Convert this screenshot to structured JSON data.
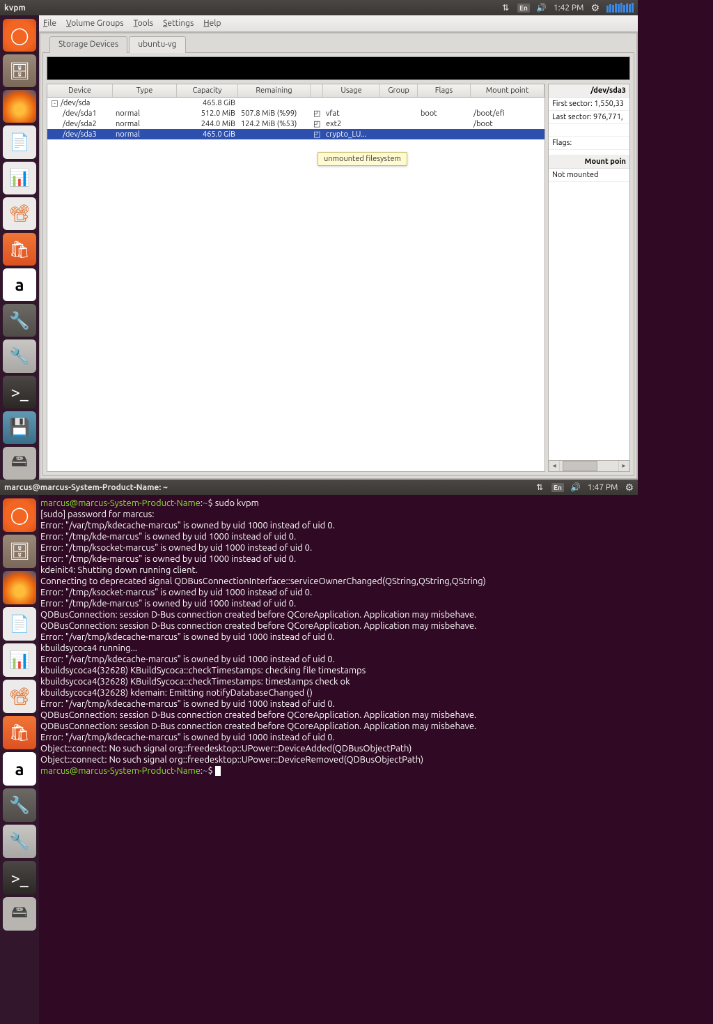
{
  "top1": {
    "title": "kvpm",
    "time": "1:42 PM",
    "lang": "En"
  },
  "top2": {
    "title": "marcus@marcus-System-Product-Name: ~",
    "time": "1:47 PM",
    "lang": "En"
  },
  "menubar": {
    "file": "File",
    "vg": "Volume Groups",
    "tools": "Tools",
    "settings": "Settings",
    "help": "Help"
  },
  "tabs": {
    "storage": "Storage Devices",
    "vg": "ubuntu-vg"
  },
  "columns": {
    "device": "Device",
    "type": "Type",
    "capacity": "Capacity",
    "remaining": "Remaining",
    "usage": "Usage",
    "group": "Group",
    "flags": "Flags",
    "mount": "Mount point"
  },
  "rows": [
    {
      "device": "/dev/sda",
      "type": "",
      "capacity": "465.8 GiB",
      "remaining": "",
      "usage": "",
      "group": "",
      "flags": "",
      "mount": "",
      "parent": true
    },
    {
      "device": "/dev/sda1",
      "type": "normal",
      "capacity": "512.0 MiB",
      "remaining": "507.8 MiB (%99)",
      "usage": "vfat",
      "group": "",
      "flags": "boot",
      "mount": "/boot/efi",
      "parent": false
    },
    {
      "device": "/dev/sda2",
      "type": "normal",
      "capacity": "244.0 MiB",
      "remaining": "124.2 MiB (%53)",
      "usage": "ext2",
      "group": "",
      "flags": "",
      "mount": "/boot",
      "parent": false
    },
    {
      "device": "/dev/sda3",
      "type": "normal",
      "capacity": "465.0 GiB",
      "remaining": "",
      "usage": "crypto_LU...",
      "group": "",
      "flags": "",
      "mount": "",
      "parent": false,
      "selected": true
    }
  ],
  "tooltip": "unmounted filesystem",
  "side": {
    "title": "/dev/sda3",
    "first": "First sector: 1,550,33",
    "last": "Last sector: 976,771,",
    "flags": "Flags:",
    "mphead": "Mount poin",
    "mpval": "Not mounted"
  },
  "term_lines": [
    {
      "p": "marcus@marcus-System-Product-Name",
      "d": "~",
      "t": "$ sudo kvpm"
    },
    {
      "t": "[sudo] password for marcus: "
    },
    {
      "t": "Error: \"/var/tmp/kdecache-marcus\" is owned by uid 1000 instead of uid 0."
    },
    {
      "t": "Error: \"/tmp/kde-marcus\" is owned by uid 1000 instead of uid 0."
    },
    {
      "t": "Error: \"/tmp/ksocket-marcus\" is owned by uid 1000 instead of uid 0."
    },
    {
      "t": "Error: \"/tmp/kde-marcus\" is owned by uid 1000 instead of uid 0."
    },
    {
      "t": "kdeinit4: Shutting down running client."
    },
    {
      "t": "Connecting to deprecated signal QDBusConnectionInterface::serviceOwnerChanged(QString,QString,QString)"
    },
    {
      "t": "Error: \"/tmp/ksocket-marcus\" is owned by uid 1000 instead of uid 0."
    },
    {
      "t": "Error: \"/tmp/kde-marcus\" is owned by uid 1000 instead of uid 0."
    },
    {
      "t": "QDBusConnection: session D-Bus connection created before QCoreApplication. Application may misbehave."
    },
    {
      "t": "QDBusConnection: session D-Bus connection created before QCoreApplication. Application may misbehave."
    },
    {
      "t": "Error: \"/var/tmp/kdecache-marcus\" is owned by uid 1000 instead of uid 0."
    },
    {
      "t": "kbuildsycoca4 running..."
    },
    {
      "t": "Error: \"/var/tmp/kdecache-marcus\" is owned by uid 1000 instead of uid 0."
    },
    {
      "t": "kbuildsycoca4(32628) KBuildSycoca::checkTimestamps: checking file timestamps"
    },
    {
      "t": "kbuildsycoca4(32628) KBuildSycoca::checkTimestamps: timestamps check ok"
    },
    {
      "t": "kbuildsycoca4(32628) kdemain: Emitting notifyDatabaseChanged ()"
    },
    {
      "t": "Error: \"/var/tmp/kdecache-marcus\" is owned by uid 1000 instead of uid 0."
    },
    {
      "t": "QDBusConnection: session D-Bus connection created before QCoreApplication. Application may misbehave."
    },
    {
      "t": "QDBusConnection: session D-Bus connection created before QCoreApplication. Application may misbehave."
    },
    {
      "t": "Error: \"/var/tmp/kdecache-marcus\" is owned by uid 1000 instead of uid 0."
    },
    {
      "t": "Object::connect: No such signal org::freedesktop::UPower::DeviceAdded(QDBusObjectPath)"
    },
    {
      "t": "Object::connect: No such signal org::freedesktop::UPower::DeviceRemoved(QDBusObjectPath)"
    },
    {
      "p": "marcus@marcus-System-Product-Name",
      "d": "~",
      "t": "$ ",
      "cursor": true
    }
  ],
  "launcher_items": [
    "ubuntu",
    "files",
    "firefox",
    "writer",
    "calc",
    "impress",
    "software",
    "amazon",
    "settings1",
    "settings2",
    "terminal",
    "disk",
    "nautilus"
  ]
}
